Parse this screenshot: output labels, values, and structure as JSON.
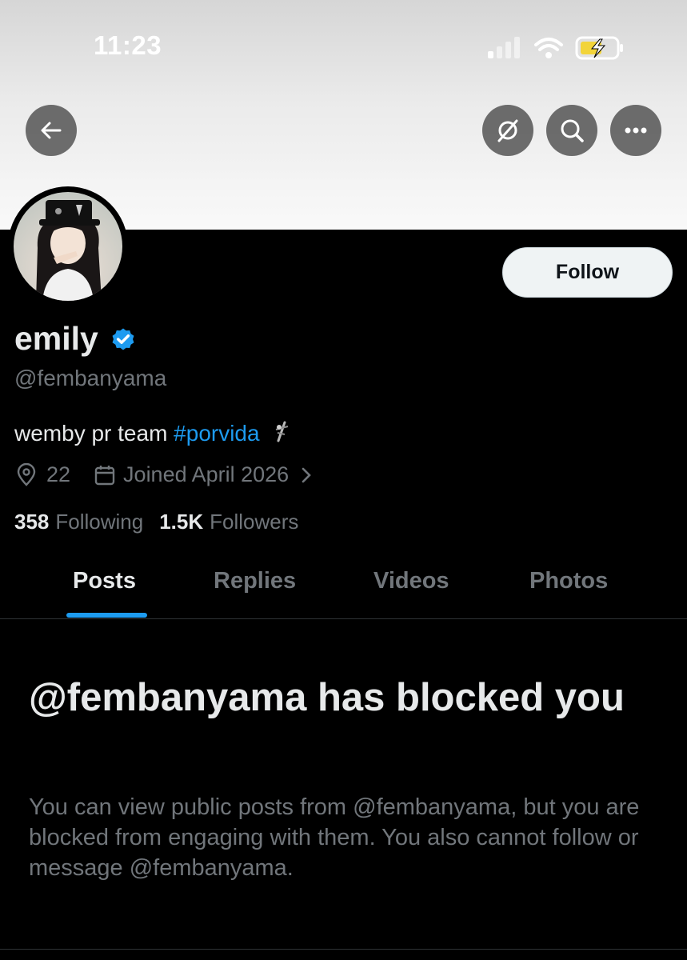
{
  "status_bar": {
    "time": "11:23"
  },
  "profile": {
    "display_name": "emily",
    "handle": "@fembanyama",
    "bio_text": "wemby pr team ",
    "bio_hashtag": "#porvida",
    "location": "22",
    "joined": "Joined April 2026",
    "following_count": "358",
    "following_label": "Following",
    "followers_count": "1.5K",
    "followers_label": "Followers",
    "follow_label": "Follow"
  },
  "tabs": [
    {
      "label": "Posts",
      "active": true
    },
    {
      "label": "Replies",
      "active": false
    },
    {
      "label": "Videos",
      "active": false
    },
    {
      "label": "Photos",
      "active": false
    }
  ],
  "blocked": {
    "title": "@fembanyama has blocked you",
    "body": "You can view public posts from @fembanyama, but you are blocked from engaging with them. You also cannot follow or message @fembanyama."
  },
  "icons": {
    "back": "back-arrow-icon",
    "grok": "grok-icon",
    "search": "search-icon",
    "more": "more-icon",
    "verified": "verified-badge-icon",
    "location": "location-pin-icon",
    "calendar": "calendar-icon"
  },
  "colors": {
    "accent": "#1d9bf0",
    "muted": "#71767b",
    "text": "#e7e9ea"
  }
}
